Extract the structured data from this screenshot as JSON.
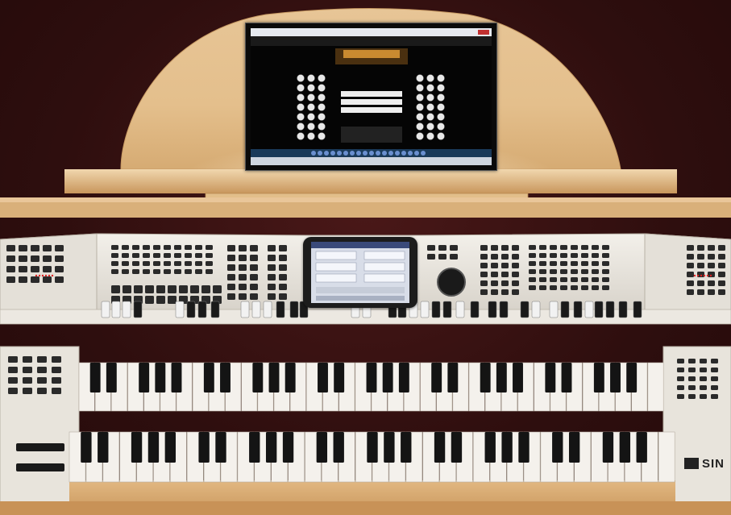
{
  "scene": {
    "subject": "",
    "brand_badge": {
      "text": "SIN"
    },
    "monitor": {
      "title_bar": "",
      "taskbar": ""
    },
    "touch_screen": {
      "header": "",
      "fields": []
    },
    "manuals": {
      "upper": {
        "octaves": 5
      },
      "lower": {
        "octaves": 5
      }
    },
    "colors": {
      "backdrop": "#3a1414",
      "wood_light": "#e9c99c",
      "wood_mid": "#d4a873",
      "wood_dark": "#b8874f",
      "console_panel": "#e8e4de",
      "button_dark": "#2a2a2a",
      "key_white": "#f4f1ec",
      "key_black": "#141414",
      "tab_white": "#f2f2f2",
      "tab_black": "#1a1a1a"
    }
  }
}
